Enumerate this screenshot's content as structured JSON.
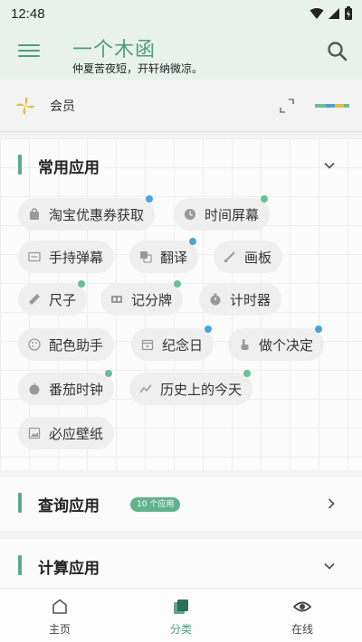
{
  "status_bar": {
    "time": "12:48"
  },
  "header": {
    "title": "一个木函",
    "subtitle": "仲夏苦夜短，开轩纳微凉。"
  },
  "member": {
    "label": "会员"
  },
  "colors": {
    "accent": "#4f9d80",
    "dot_blue": "#4aa3d8",
    "dot_green": "#6bbf95"
  },
  "common_apps": {
    "title": "常用应用",
    "items": [
      {
        "label": "淘宝优惠券获取",
        "icon": "bag-icon",
        "dot": "blue"
      },
      {
        "label": "时间屏幕",
        "icon": "clock-icon",
        "dot": "green"
      },
      {
        "label": "手持弹幕",
        "icon": "screen-text-icon",
        "dot": ""
      },
      {
        "label": "翻译",
        "icon": "translate-icon",
        "dot": "blue"
      },
      {
        "label": "画板",
        "icon": "brush-icon",
        "dot": ""
      },
      {
        "label": "尺子",
        "icon": "ruler-icon",
        "dot": "green"
      },
      {
        "label": "记分牌",
        "icon": "scoreboard-icon",
        "dot": "green"
      },
      {
        "label": "计时器",
        "icon": "stopwatch-icon",
        "dot": ""
      },
      {
        "label": "配色助手",
        "icon": "palette-icon",
        "dot": ""
      },
      {
        "label": "纪念日",
        "icon": "calendar-icon",
        "dot": "blue"
      },
      {
        "label": "做个决定",
        "icon": "hand-icon",
        "dot": "blue"
      },
      {
        "label": "番茄时钟",
        "icon": "tomato-icon",
        "dot": "green"
      },
      {
        "label": "历史上的今天",
        "icon": "trend-icon",
        "dot": "green"
      },
      {
        "label": "必应壁纸",
        "icon": "wallpaper-icon",
        "dot": ""
      }
    ]
  },
  "query_apps": {
    "title": "查询应用",
    "badge": "10 个应用"
  },
  "calc_apps": {
    "title": "计算应用"
  },
  "nav": {
    "items": [
      {
        "label": "主页",
        "icon": "home-icon"
      },
      {
        "label": "分类",
        "icon": "category-icon"
      },
      {
        "label": "在线",
        "icon": "eye-icon"
      }
    ]
  }
}
